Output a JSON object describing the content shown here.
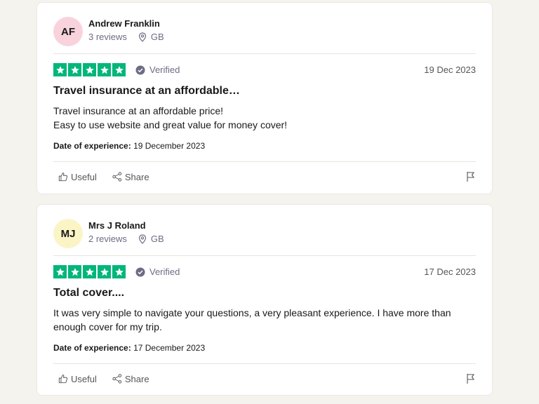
{
  "reviews": [
    {
      "initials": "AF",
      "avatar_color": "#f9d3dc",
      "name": "Andrew Franklin",
      "review_count": "3 reviews",
      "country": "GB",
      "verified_label": "Verified",
      "date": "19 Dec 2023",
      "title": "Travel insurance at an affordable…",
      "body_lines": [
        "Travel insurance at an affordable price!",
        "Easy to use website and great value for money cover!"
      ],
      "experience_label": "Date of experience:",
      "experience_date": "19 December 2023",
      "useful_label": "Useful",
      "share_label": "Share",
      "rating": 5
    },
    {
      "initials": "MJ",
      "avatar_color": "#fbf4c5",
      "name": "Mrs J Roland",
      "review_count": "2 reviews",
      "country": "GB",
      "verified_label": "Verified",
      "date": "17 Dec 2023",
      "title": "Total cover....",
      "body_lines": [
        "It was very simple to navigate your questions, a very pleasant experience. I have more than enough cover for my trip."
      ],
      "experience_label": "Date of experience:",
      "experience_date": "17 December 2023",
      "useful_label": "Useful",
      "share_label": "Share",
      "rating": 5
    }
  ],
  "colors": {
    "star_green": "#00b67a",
    "background": "#f4f3ee"
  }
}
